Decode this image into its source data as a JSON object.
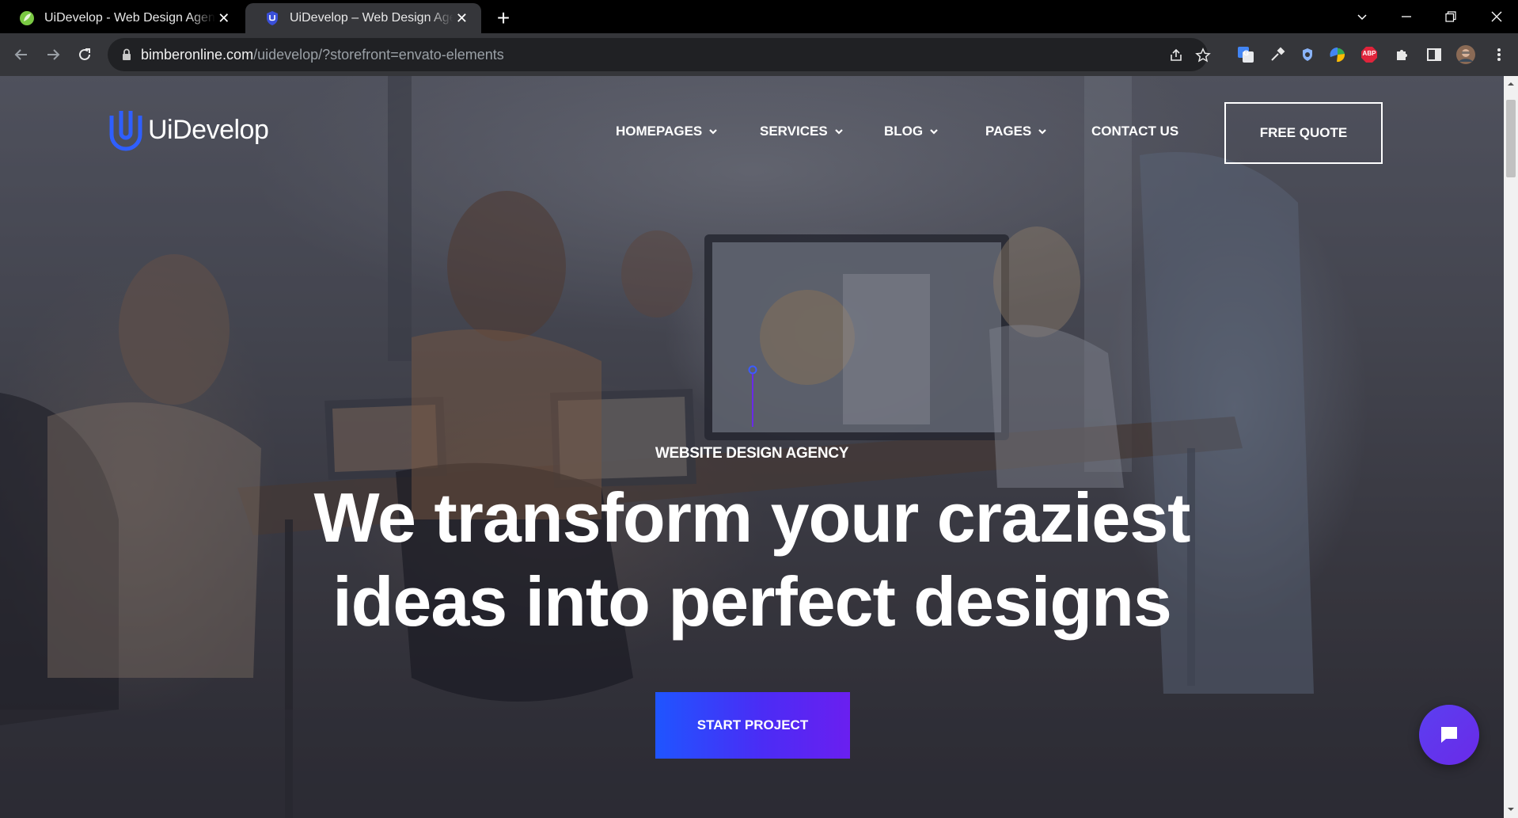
{
  "browser": {
    "tabs": [
      {
        "title": "UiDevelop - Web Design Agency",
        "active": false,
        "favicon": "leaf-icon"
      },
      {
        "title": "UiDevelop – Web Design Agency",
        "active": true,
        "favicon": "uidevelop-shield-icon"
      }
    ],
    "new_tab_symbol": "+",
    "close_symbol": "✕",
    "url_host": "bimberonline.com",
    "url_path": "/uidevelop/?storefront=envato-elements",
    "extensions": [
      "translate-icon",
      "eyedropper-icon",
      "shield-extension-icon",
      "color-wheel-icon",
      "adblock-icon",
      "puzzle-icon",
      "sidebar-icon",
      "profile-avatar",
      "menu-icon"
    ],
    "adblock_label": "ABP"
  },
  "site": {
    "logo_text": "UiDevelop",
    "nav": [
      {
        "label": "HOMEPAGES",
        "has_dropdown": true
      },
      {
        "label": "SERVICES",
        "has_dropdown": true
      },
      {
        "label": "BLOG",
        "has_dropdown": true
      },
      {
        "label": "PAGES",
        "has_dropdown": true
      },
      {
        "label": "CONTACT US",
        "has_dropdown": false
      }
    ],
    "quote_button": "FREE QUOTE",
    "hero": {
      "eyebrow": "WEBSITE DESIGN AGENCY",
      "headline_line1": "We transform your craziest",
      "headline_line2": "ideas into perfect designs",
      "cta": "START PROJECT"
    },
    "chat_widget": "chat-icon"
  },
  "colors": {
    "accent_blue": "#1f55ff",
    "accent_purple": "#6a1ff0",
    "chat_purple": "#5b3ff0",
    "logo_blue": "#2f5fff"
  }
}
